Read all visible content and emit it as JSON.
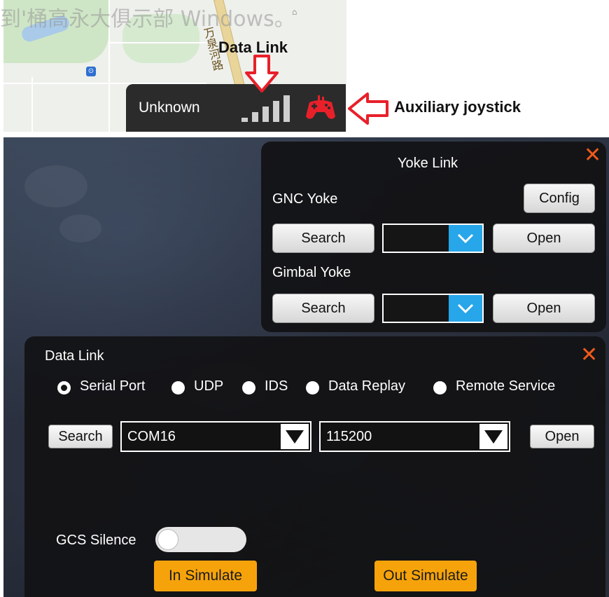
{
  "top": {
    "watermark": "到'桶高永大俱示部 Windows。",
    "road_label": "万泉河路",
    "status_text": "Unknown",
    "annotation_datalink": "Data Link",
    "annotation_joystick": "Auxiliary joystick",
    "accent_red": "#e8202a"
  },
  "yoke_panel": {
    "title": "Yoke Link",
    "close": "✕",
    "gnc_label": "GNC Yoke",
    "config_label": "Config",
    "gnc_search_label": "Search",
    "gnc_open_label": "Open",
    "gimbal_label": "Gimbal Yoke",
    "gimbal_search_label": "Search",
    "gimbal_open_label": "Open"
  },
  "data_panel": {
    "title": "Data Link",
    "close": "✕",
    "modes": [
      "Serial Port",
      "UDP",
      "IDS",
      "Data Replay",
      "Remote Service"
    ],
    "selected_mode": "Serial Port",
    "search_label": "Search",
    "port_value": "COM16",
    "baud_value": "115200",
    "open_label": "Open",
    "gcs_silence_label": "GCS Silence",
    "gcs_silence_on": false,
    "in_simulate_label": "In Simulate",
    "out_simulate_label": "Out Simulate",
    "accent_orange": "#f6a30b",
    "accent_blue": "#27a6ea"
  }
}
